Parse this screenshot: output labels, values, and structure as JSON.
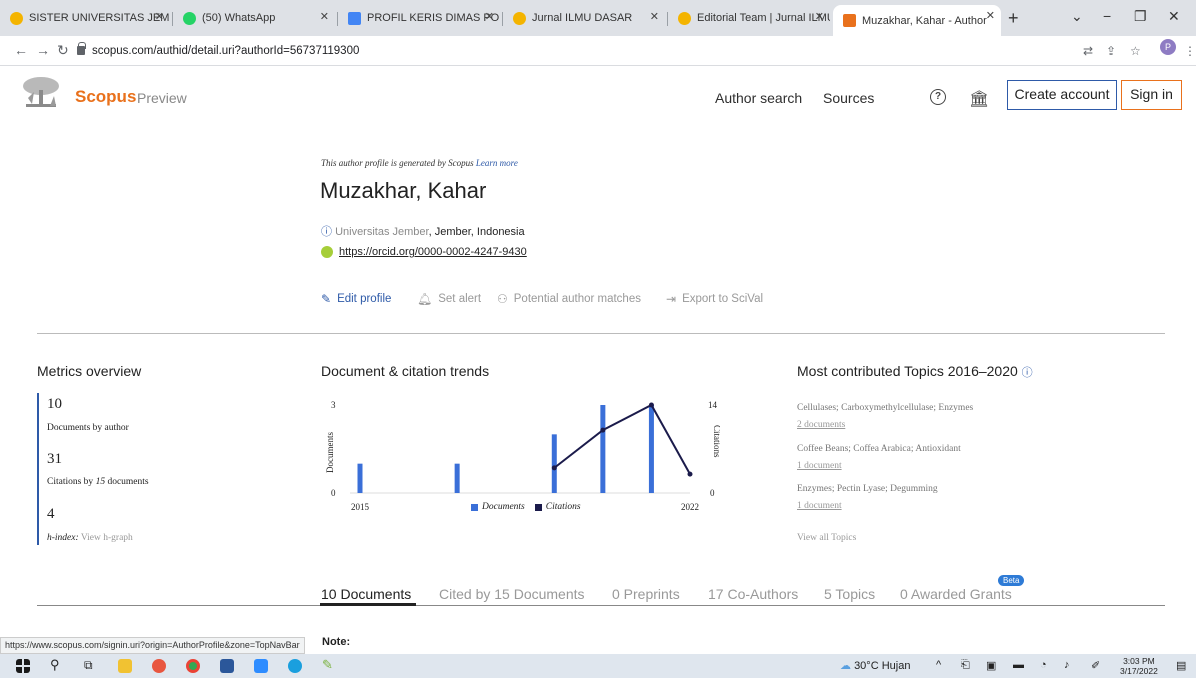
{
  "browser": {
    "tabs": [
      {
        "title": "SISTER UNIVERSITAS JEMBE",
        "color": "#f4b400"
      },
      {
        "title": "(50) WhatsApp",
        "color": "#25d366"
      },
      {
        "title": "PROFIL KERIS DIMAS PO.d",
        "color": "#4285f4"
      },
      {
        "title": "Jurnal ILMU DASAR",
        "color": "#f4b400"
      },
      {
        "title": "Editorial Team | Jurnal ILMU",
        "color": "#f4b400"
      },
      {
        "title": "Muzakhar, Kahar - Author",
        "color": "#e9711c"
      }
    ],
    "url": "scopus.com/authid/detail.uri?authorId=56737119300",
    "profile_initial": "P"
  },
  "header": {
    "brand": "Scopus",
    "brand_sub": "Preview",
    "author_search": "Author search",
    "sources": "Sources",
    "help_glyph": "?",
    "create_account": "Create account",
    "sign_in": "Sign in"
  },
  "author": {
    "generated_note": "This author profile is generated by Scopus",
    "learn_more": "Learn more",
    "name": "Muzakhar, Kahar",
    "affiliation_uni": "Universitas Jember",
    "affiliation_rest": ", Jember, Indonesia",
    "orcid": "https://orcid.org/0000-0002-4247-9430"
  },
  "actions": {
    "edit_profile": "Edit profile",
    "set_alert": "Set alert",
    "potential_matches": "Potential author matches",
    "export": "Export to SciVal"
  },
  "metrics": {
    "title": "Metrics overview",
    "documents_value": "10",
    "documents_label": "Documents by author",
    "citations_value": "31",
    "citations_label_pre": "Citations by",
    "citations_label_num": "15",
    "citations_label_post": "documents",
    "hindex_value": "4",
    "hindex_label": "h-index:",
    "hindex_link": "View h-graph"
  },
  "trends": {
    "title": "Document & citation trends",
    "legend_documents": "Documents",
    "legend_citations": "Citations",
    "colors": {
      "documents": "#3a6fd8",
      "citations": "#1b1b4b"
    }
  },
  "chart_data": {
    "type": "bar",
    "x": [
      2015,
      2016,
      2017,
      2018,
      2019,
      2020,
      2021,
      2022
    ],
    "x_tick_labels": [
      "2015",
      "2022"
    ],
    "series": [
      {
        "name": "Documents",
        "axis": "left",
        "values": [
          1,
          0,
          1,
          0,
          2,
          3,
          3,
          0
        ]
      },
      {
        "name": "Citations",
        "axis": "right",
        "type": "line",
        "x": [
          2019,
          2020,
          2021,
          2022
        ],
        "values": [
          4,
          10,
          14,
          3
        ]
      }
    ],
    "ylabel_left": "Documents",
    "ylabel_right": "Citations",
    "ylim_left": [
      0,
      3
    ],
    "ylim_right": [
      0,
      14
    ],
    "left_ticks": [
      "3",
      "0"
    ],
    "right_ticks": [
      "14",
      "0"
    ]
  },
  "topics": {
    "title": "Most contributed Topics 2016–2020",
    "items": [
      {
        "name": "Cellulases; Carboxymethylcellulase; Enzymes",
        "docs": "2 documents"
      },
      {
        "name": "Coffee Beans; Coffea Arabica; Antioxidant",
        "docs": "1 document"
      },
      {
        "name": "Enzymes; Pectin Lyase; Degumming",
        "docs": "1 document"
      }
    ],
    "view_all": "View all Topics"
  },
  "doc_tabs": [
    "10 Documents",
    "Cited by 15 Documents",
    "0 Preprints",
    "17 Co-Authors",
    "5 Topics",
    "0 Awarded Grants"
  ],
  "beta_badge": "Beta",
  "note": "Note:",
  "status_url": "https://www.scopus.com/signin.uri?origin=AuthorProfile&zone=TopNavBar",
  "taskbar": {
    "weather": "30°C Hujan",
    "time": "3:03 PM",
    "date": "3/17/2022"
  }
}
